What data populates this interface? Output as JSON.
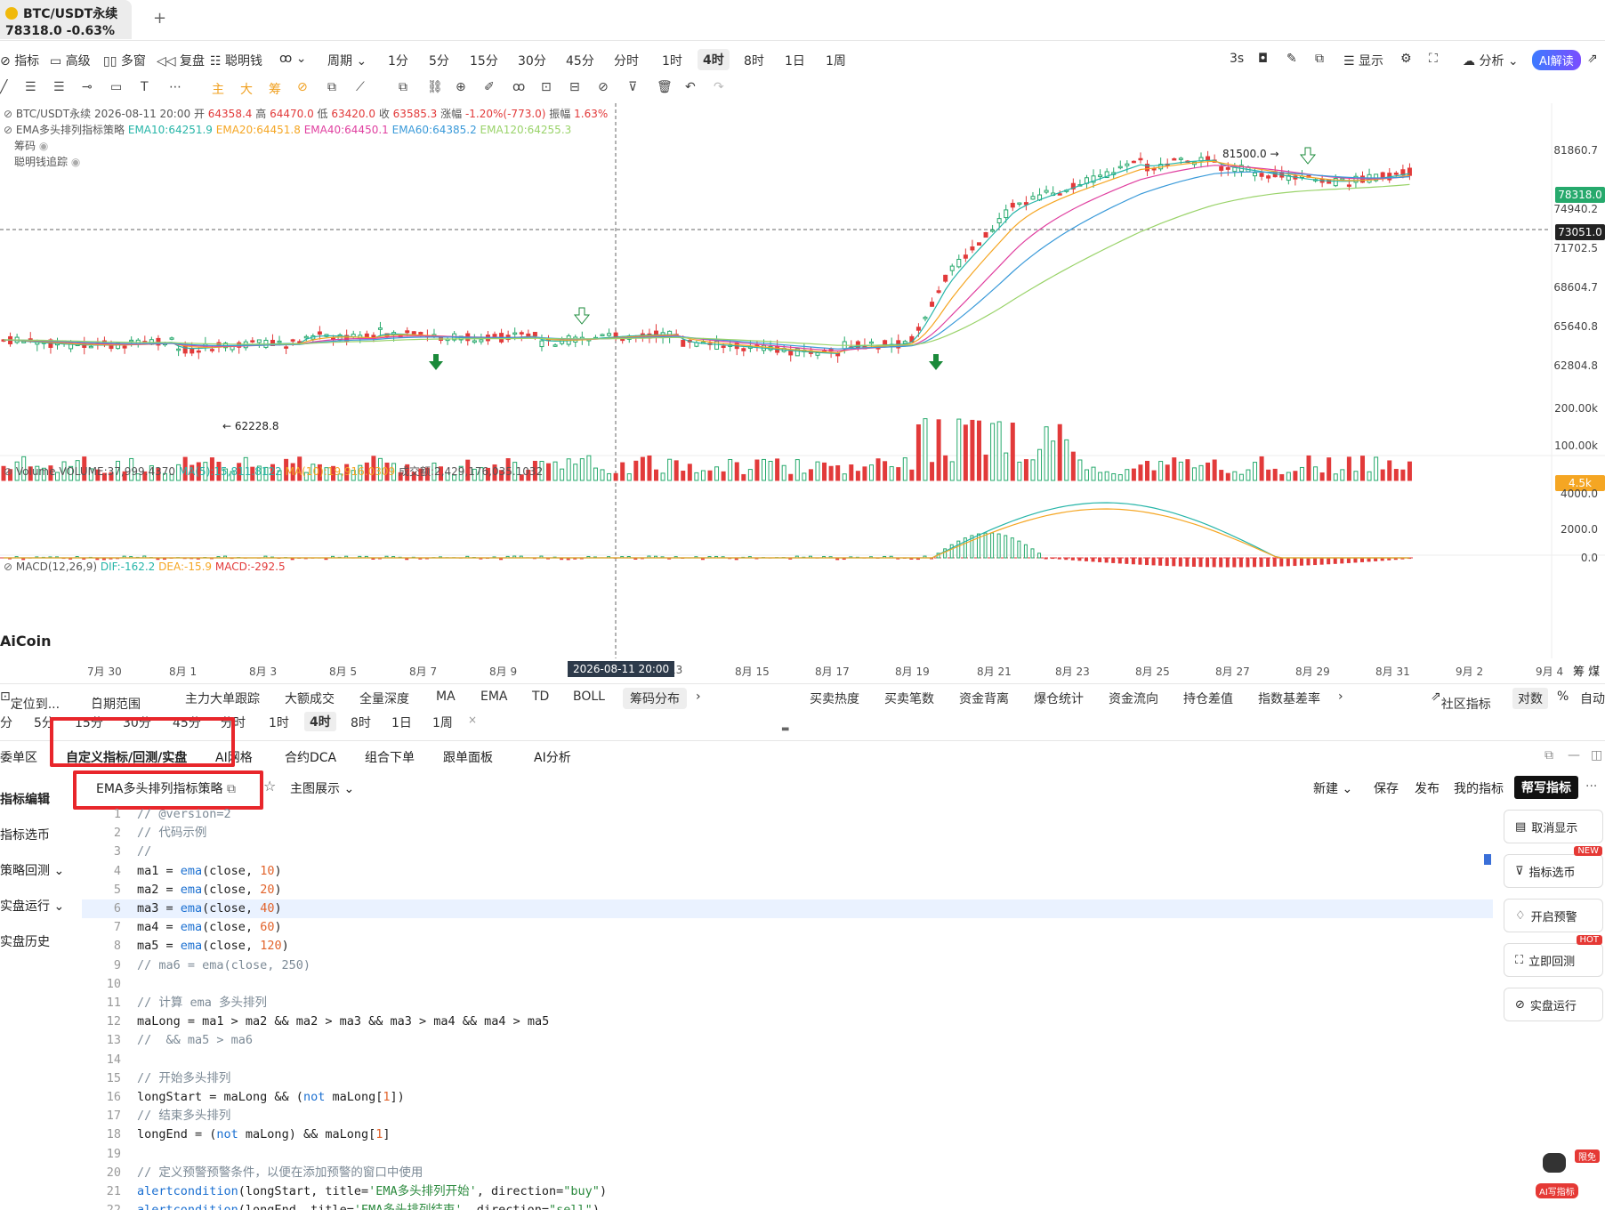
{
  "tab": {
    "symbol": "BTC/USDT永续",
    "price_change": "78318.0 -0.63%",
    "add": "+"
  },
  "toolbar": {
    "indicator": "指标",
    "advanced": "高级",
    "multi": "多窗",
    "replay": "复盘",
    "smart": "聪明钱",
    "period": "周期",
    "tf": [
      "1分",
      "5分",
      "15分",
      "30分",
      "45分",
      "分时",
      "1时",
      "4时",
      "8时",
      "1日",
      "1周"
    ],
    "refresh": "3s",
    "display": "显示",
    "analysis": "分析",
    "ai_read": "AI解读"
  },
  "drawbar": {
    "main": "主",
    "big": "大",
    "chip": "筹"
  },
  "legend": {
    "ohlc_symbol": "BTC/USDT永续",
    "ohlc_time": "2026-08-11 20:00",
    "open_label": "开",
    "open": "64358.4",
    "high_label": "高",
    "high": "64470.0",
    "low_label": "低",
    "low": "63420.0",
    "close_label": "收",
    "close": "63585.3",
    "chg_label": "涨幅",
    "chg": "-1.20%(-773.0)",
    "amp_label": "振幅",
    "amp": "1.63%",
    "ema_title": "EMA多头排列指标策略",
    "ema10": "EMA10:64251.9",
    "ema20": "EMA20:64451.8",
    "ema40": "EMA40:64450.1",
    "ema60": "EMA60:64385.2",
    "ema120": "EMA120:64255.3",
    "chip": "筹码",
    "smart": "聪明钱追踪",
    "volume": "Volume",
    "volume_val": "VOLUME:37,999.4370",
    "ma5": "MA(5):15,811.8122",
    "ma10": "MA(10):19,916.0309",
    "turnover": "成交额:2,429,176,035.1032",
    "macd": "MACD(12,26,9)",
    "dif": "DIF:-162.2",
    "dea": "DEA:-15.9",
    "macd_val": "MACD:-292.5"
  },
  "price_axis": [
    "81860.7",
    "74940.2",
    "71702.5",
    "68604.7",
    "65640.8",
    "62804.8"
  ],
  "price_tags": {
    "last": "78318.0",
    "cursor": "73051.0",
    "vol_tag": "4.5k"
  },
  "volume_axis": [
    "200.00k",
    "100.00k"
  ],
  "macd_axis": [
    "4000.0",
    "2000.0",
    "0.0"
  ],
  "annotations": {
    "high": "81500.0 →",
    "low": "← 62228.8",
    "brand": "AiCoin"
  },
  "x_axis": [
    "7月 30",
    "8月 1",
    "8月 3",
    "8月 5",
    "8月 7",
    "8月 9",
    "13",
    "8月 15",
    "8月 17",
    "8月 19",
    "8月 21",
    "8月 23",
    "8月 25",
    "8月 27",
    "8月 29",
    "8月 31",
    "9月 2",
    "9月 4"
  ],
  "x_cursor": "2026-08-11 20:00",
  "x_right": "筹 煤",
  "indicators": {
    "locate": "定位到...",
    "range": "日期范围",
    "items": [
      "主力大单跟踪",
      "大额成交",
      "全量深度",
      "MA",
      "EMA",
      "TD",
      "BOLL",
      "筹码分布"
    ],
    "items2": [
      "买卖热度",
      "买卖笔数",
      "资金背离",
      "爆仓统计",
      "资金流向",
      "持仓差值",
      "指数基差率"
    ],
    "community": "社区指标",
    "log": "对数",
    "pct": "%",
    "auto": "自动"
  },
  "tfrow": [
    "分",
    "5分",
    "15分",
    "30分",
    "45分",
    "分时",
    "1时",
    "4时",
    "8时",
    "1日",
    "1周",
    "×"
  ],
  "panel_tabs": [
    "委单区",
    "自定义指标/回测/实盘",
    "AI网格",
    "合约DCA",
    "组合下单",
    "跟单面板",
    "AI分析"
  ],
  "subhead": {
    "strategy": "EMA多头排列指标策略",
    "main_display": "主图展示",
    "new": "新建",
    "save": "保存",
    "publish": "发布",
    "mine": "我的指标",
    "help": "帮写指标",
    "more": "···"
  },
  "sidebar": [
    "指标编辑",
    "指标选币",
    "策略回测",
    "实盘运行",
    "实盘历史"
  ],
  "right_buttons": [
    {
      "label": "取消显示",
      "badge": ""
    },
    {
      "label": "指标选币",
      "badge": "NEW"
    },
    {
      "label": "开启预警",
      "badge": ""
    },
    {
      "label": "立即回测",
      "badge": "HOT"
    },
    {
      "label": "实盘运行",
      "badge": ""
    }
  ],
  "bottom_bot": {
    "limited": "限免",
    "ai_write": "AI写指标"
  },
  "code": [
    "// @version=2",
    "// 代码示例",
    "//",
    "ma1 = ema(close, 10)",
    "ma2 = ema(close, 20)",
    "ma3 = ema(close, 40)",
    "ma4 = ema(close, 60)",
    "ma5 = ema(close, 120)",
    "// ma6 = ema(close, 250)",
    "",
    "// 计算 ema 多头排列",
    "maLong = ma1 > ma2 && ma2 > ma3 && ma3 > ma4 && ma4 > ma5",
    "//  && ma5 > ma6",
    "",
    "// 开始多头排列",
    "longStart = maLong && (not maLong[1])",
    "// 结束多头排列",
    "longEnd = (not maLong) && maLong[1]",
    "",
    "// 定义预警预警条件，以便在添加预警的窗口中使用",
    "alertcondition(longStart, title='EMA多头排列开始', direction=\"buy\")",
    "alertcondition(longEnd, title='EMA多头排列结束', direction=\"sell\")"
  ]
}
